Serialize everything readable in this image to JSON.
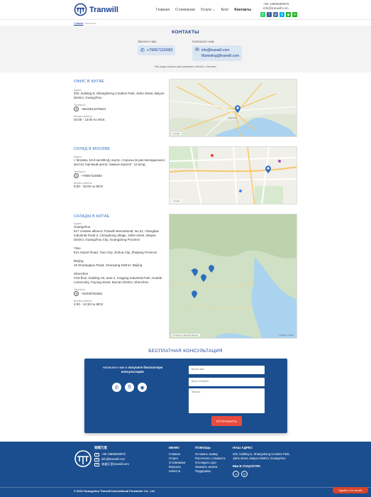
{
  "header": {
    "brand": "Tranwill",
    "nav": [
      "Главная",
      "О компании",
      "Услуги ⌄",
      "Блог",
      "Контакты"
    ],
    "active_nav": "Контакты",
    "phone": "+86 13809280970",
    "email": "info@tranwill.com",
    "socials": [
      {
        "name": "whatsapp-icon",
        "glyph": "✆",
        "color": "#25d366"
      },
      {
        "name": "facebook-icon",
        "glyph": "f",
        "color": "#3b5998"
      },
      {
        "name": "vk-icon",
        "glyph": "в",
        "color": "#4c75a3"
      },
      {
        "name": "skype-icon",
        "glyph": "S",
        "color": "#00aff0"
      },
      {
        "name": "wechat-icon",
        "glyph": "◉",
        "color": "#1aad19"
      },
      {
        "name": "mail-icon",
        "glyph": "✉",
        "color": "#1aad19"
      }
    ]
  },
  "breadcrumb": {
    "home": "Главная",
    "current": "Контакты"
  },
  "page_title": "КОНТАКТЫ",
  "call": {
    "label": "Звоните нам",
    "phone": "+79067115683"
  },
  "write": {
    "label": "Напишите нам",
    "email1": "info@tranwill.com",
    "email2": "Marketing@tranwill.com"
  },
  "tagline": "Мы рады помочь вам развивать бизнес с Китаем",
  "offices": [
    {
      "title": "ОФИС В КИТАЕ",
      "address_label": "Адрес:",
      "address": "402, building 5, Shangsheng Creative Park, Jiahe street, Baiyun District, Guangzhou",
      "phone_label": "Телефон:",
      "phone": "+8615914275544",
      "hours_label": "Время работы:",
      "hours": "04:00 - 13:00 по МСК",
      "map_city": "Гуанчжоу"
    },
    {
      "title": "СКЛАД В МОСКВЕ",
      "address_label": "Адрес:",
      "address": "г. Москва, 19-й км МКАД, внутр. стороны (в рне Бесединского моста) торговый центр \"южные ворота\", 12 вход.",
      "phone_label": "Телефон:",
      "phone": "+79067115683",
      "hours_label": "Время работы:",
      "hours": "9:00 - 18:00 по МСК"
    },
    {
      "title": "СКЛАДЫ В КИТАЕ",
      "address_label": "Адрес:",
      "blocks": [
        "Guangzhou\n517 creative alliance Tranwill international, No.21, changban Industrial Road 2, Changhong village, Jiahe street, Baiyun District, Guangzhou City, Guangdong Province",
        "Yiwu\n621 Airport Road, Yiwu City, Jinhua City, Zhejiang Province",
        "Beijing\n18 Shuangqiao Road, Chaoyang District, Beijing",
        "Shenzhen\nFirst floor, building A8, area 2, Cuigang Industrial Park, Huaide community, Fuyong street, Bao'an District, Shenzhen"
      ],
      "phone_label": "Телефон:",
      "phone": "+02036791582",
      "hours_label": "Время работы:",
      "hours": "4:00 - 14:30 по МСК"
    }
  ],
  "map_badge": "Google",
  "map_note": "Открыть в Яндекс.Картах",
  "map_copyright": "© Яндекс Условия",
  "consult": {
    "title": "БЕСПЛАТНАЯ КОНСУЛЬТАЦИЯ",
    "text_pre": "Напишите нам и",
    "text_bold": "получите бесплатную консультацию",
    "name_placeholder": "Ваше имя",
    "phone_placeholder": "Ваш телефон",
    "message_placeholder": "Запрос",
    "submit": "ОТПРАВИТЬ"
  },
  "footer": {
    "brand_cn": "穿越万里",
    "phone": "+86 13809280970",
    "email1": "info@tranwill.com",
    "wechat": "穿越万里tranwill.com",
    "menu_title": "МЕНЮ",
    "menu": [
      "Главная",
      "Услуги",
      "О компании",
      "Вопросы",
      "Новости"
    ],
    "help_title": "ПОМОЩЬ",
    "help": [
      "Оставить заявку",
      "Рассчитать стоимость",
      "Отследить груз",
      "Заказать звонок",
      "Поддержка"
    ],
    "addr_title": "НАШ АДРЕС",
    "addr": "402, building 5, Shangsheng Creative Park, Jiahe street, Baiyun District, Guangzhou",
    "social_title": "МЫ В СОЦСЕТЯХ",
    "copyright": "© 2022 Guangzhou Tranwill International Forwarder Co., Ltd",
    "chat_badge": "Задайте ● Ок Онлайн"
  }
}
